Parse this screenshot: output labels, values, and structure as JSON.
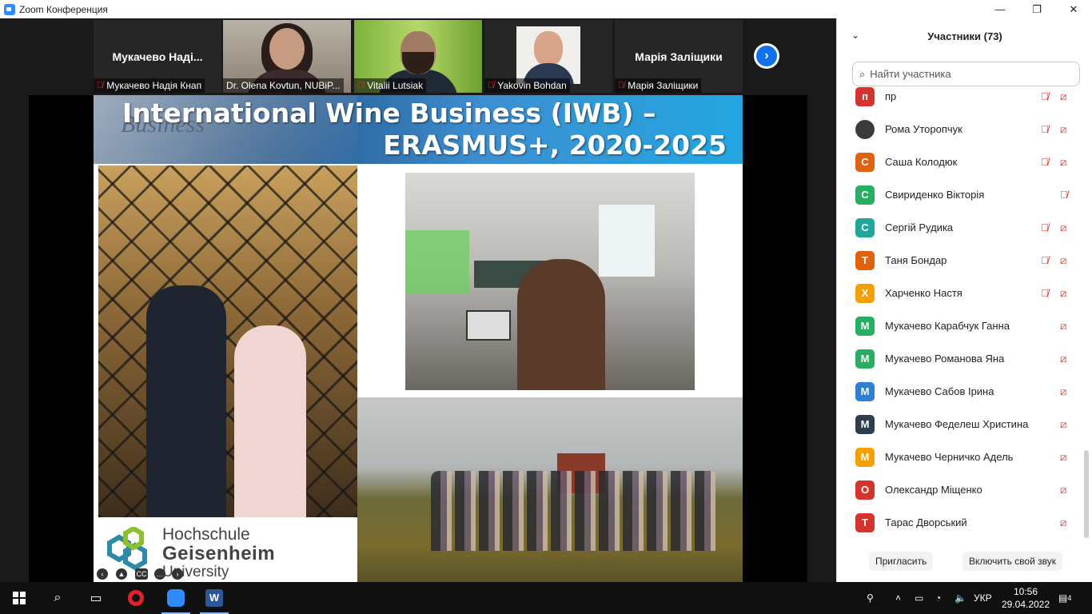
{
  "window": {
    "title": "Zoom Конференция",
    "controls": [
      "—",
      "❐",
      "✕"
    ]
  },
  "video_strip": {
    "tiles": [
      {
        "big_name": "Мукачево  Наді...",
        "caption": "Мукачево Надія Кнап",
        "muted": true,
        "video": false
      },
      {
        "big_name": "",
        "caption": "Dr. Olena Kovtun, NUBiP...",
        "muted": false,
        "video": true,
        "active": true
      },
      {
        "big_name": "",
        "caption": "Vitalii Lutsiak",
        "muted": true,
        "video": true
      },
      {
        "big_name": "",
        "caption": "Yakovin Bohdan",
        "muted": true,
        "video": true
      },
      {
        "big_name": "Марія Заліщики",
        "caption": "Марія Заліщики",
        "muted": true,
        "video": false
      }
    ],
    "next_icon": "chevron-right-icon"
  },
  "slide": {
    "title_line1": "International Wine Business (IWB) –",
    "title_line2": "ERASMUS+, 2020-2025",
    "banner_bg_word": "Business",
    "logo_line1": "Hochschule",
    "logo_line2": "Geisenheim",
    "logo_line3": "University",
    "controls": [
      "prev-icon",
      "pointer-icon",
      "cc-icon",
      "more-icon",
      "next-icon"
    ]
  },
  "participants": {
    "header": "Участники (73)",
    "search_placeholder": "Найти участника",
    "items": [
      {
        "initial": "п",
        "name": "пр",
        "color": "#d6322e",
        "mic_muted": true,
        "cam_off": true
      },
      {
        "initial": "",
        "name": "Рома Уторопчук",
        "color": "#3a3a3a",
        "mic_muted": true,
        "cam_off": true,
        "photo": true
      },
      {
        "initial": "С",
        "name": "Саша Колодюк",
        "color": "#e0620f",
        "mic_muted": true,
        "cam_off": true
      },
      {
        "initial": "С",
        "name": "Свириденко Вікторія",
        "color": "#27ae60",
        "mic_muted": true,
        "cam_off": false
      },
      {
        "initial": "С",
        "name": "Сергій Рудика",
        "color": "#1fa89a",
        "mic_muted": true,
        "cam_off": true
      },
      {
        "initial": "Т",
        "name": "Таня Бондар",
        "color": "#e0620f",
        "mic_muted": true,
        "cam_off": true
      },
      {
        "initial": "Х",
        "name": "Харченко Настя",
        "color": "#f5a000",
        "mic_muted": true,
        "cam_off": true
      },
      {
        "initial": "М",
        "name": "Мукачево Карабчук Ганна",
        "color": "#27ae60",
        "mic_muted": false,
        "cam_off": true
      },
      {
        "initial": "М",
        "name": "Мукачево Романова Яна",
        "color": "#27ae60",
        "mic_muted": false,
        "cam_off": true
      },
      {
        "initial": "М",
        "name": "Мукачево Сабов Ірина",
        "color": "#2d7fd0",
        "mic_muted": false,
        "cam_off": true
      },
      {
        "initial": "М",
        "name": "Мукачево Феделеш Христина",
        "color": "#2f3e4e",
        "mic_muted": false,
        "cam_off": true
      },
      {
        "initial": "М",
        "name": "Мукачево Черничко Адель",
        "color": "#f5a000",
        "mic_muted": false,
        "cam_off": true
      },
      {
        "initial": "О",
        "name": "Олександр Міщенко",
        "color": "#d6322e",
        "mic_muted": false,
        "cam_off": true
      },
      {
        "initial": "Т",
        "name": "Тарас Дворський",
        "color": "#d6322e",
        "mic_muted": false,
        "cam_off": true
      }
    ],
    "invite_label": "Пригласить",
    "unmute_label": "Включить свой звук"
  },
  "taskbar": {
    "language": "УКР",
    "time": "10:56",
    "date": "29.04.2022",
    "notifications": "4"
  },
  "colors": {
    "muted_red": "#e02828",
    "zoom_blue": "#0e72ed",
    "active_speaker": "#9bc53d"
  }
}
